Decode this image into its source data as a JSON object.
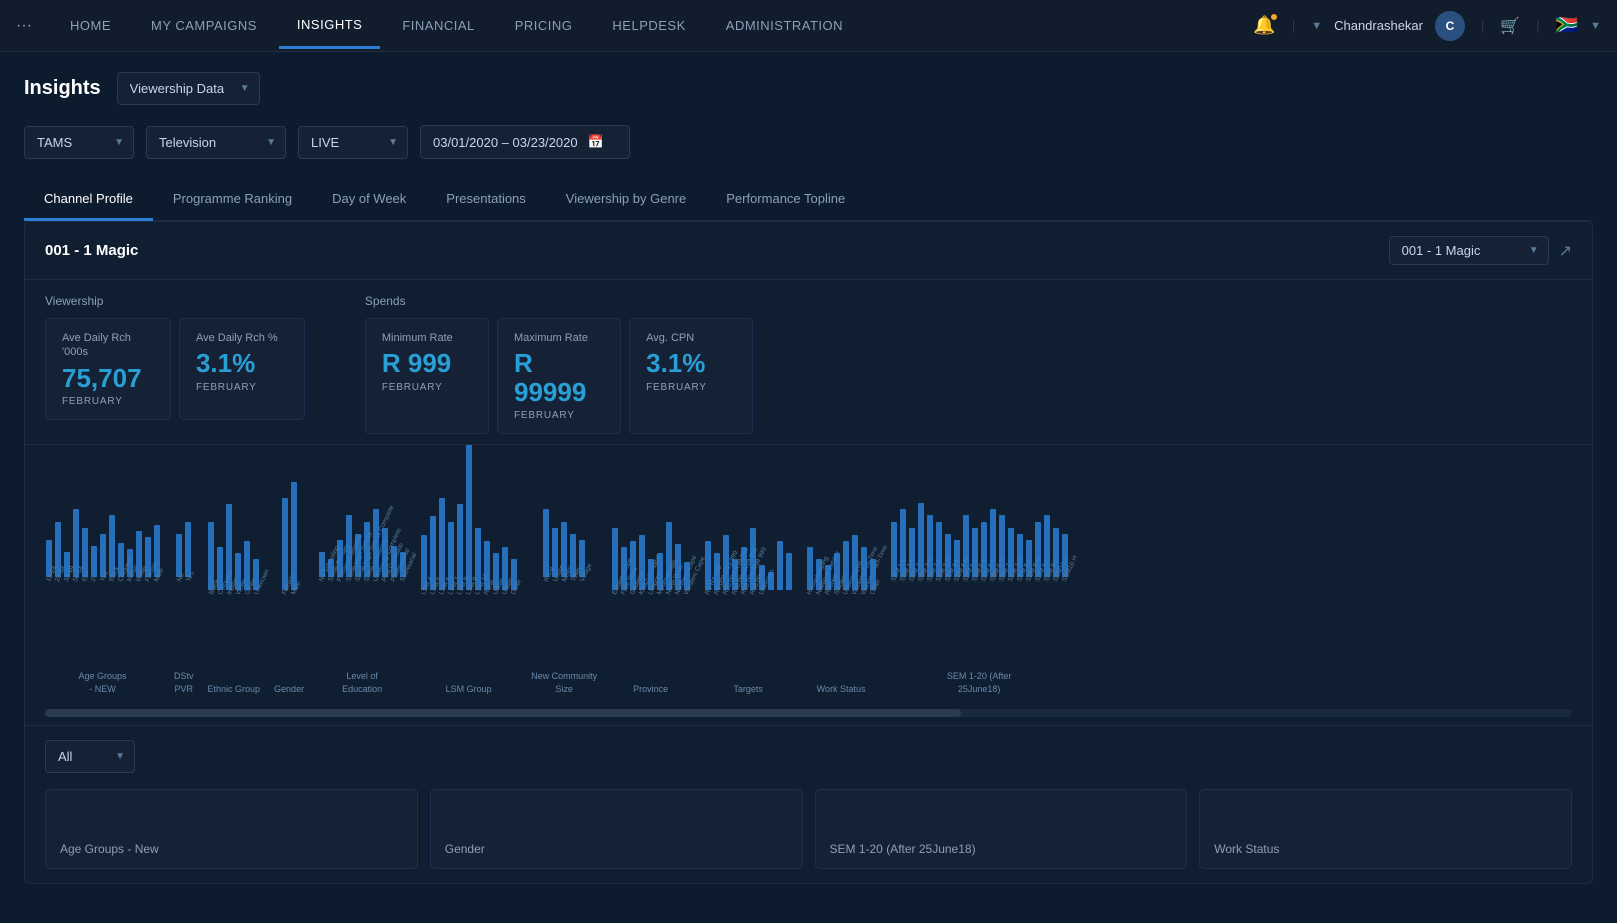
{
  "nav": {
    "dots_label": "···",
    "links": [
      {
        "label": "HOME",
        "active": false
      },
      {
        "label": "MY CAMPAIGNS",
        "active": false
      },
      {
        "label": "INSIGHTS",
        "active": true
      },
      {
        "label": "FINANCIAL",
        "active": false
      },
      {
        "label": "PRICING",
        "active": false
      },
      {
        "label": "HELPDESK",
        "active": false
      },
      {
        "label": "ADMINISTRATION",
        "active": false
      }
    ],
    "user_name": "Chandrashekar",
    "avatar_initials": "C"
  },
  "page": {
    "title": "Insights",
    "dropdown_label": "Viewership Data"
  },
  "filters": {
    "tams": "TAMS",
    "television": "Television",
    "live": "LIVE",
    "date_range": "03/01/2020 – 03/23/2020"
  },
  "tabs": [
    {
      "label": "Channel Profile",
      "active": true
    },
    {
      "label": "Programme Ranking",
      "active": false
    },
    {
      "label": "Day of Week",
      "active": false
    },
    {
      "label": "Presentations",
      "active": false
    },
    {
      "label": "Viewership by Genre",
      "active": false
    },
    {
      "label": "Performance Topline",
      "active": false
    }
  ],
  "channel_card": {
    "title": "001 - 1 Magic",
    "channel_select": "001 - 1 Magic"
  },
  "viewership_label": "Viewership",
  "spends_label": "Spends",
  "metrics": [
    {
      "label": "Ave Daily Rch '000s",
      "value": "75,707",
      "period": "FEBRUARY"
    },
    {
      "label": "Ave Daily Rch %",
      "value": "3.1%",
      "period": "FEBRUARY"
    },
    {
      "label": "Minimum Rate",
      "value": "R 999",
      "period": "FEBRUARY"
    },
    {
      "label": "Maximum Rate",
      "value": "R 99999",
      "period": "FEBRUARY"
    },
    {
      "label": "Avg. CPN",
      "value": "3.1%",
      "period": "FEBRUARY"
    }
  ],
  "chart": {
    "groups": [
      {
        "name": "Age Groups\n- NEW",
        "bars": [
          12,
          18,
          8,
          22,
          16,
          10,
          14,
          20,
          11,
          9,
          15,
          13,
          17
        ]
      },
      {
        "name": "DStv\nPVR",
        "bars": [
          14,
          18
        ]
      },
      {
        "name": "Ethnic Group",
        "bars": [
          22,
          14,
          28,
          12,
          16,
          10
        ]
      },
      {
        "name": "Gender",
        "bars": [
          30,
          35
        ]
      },
      {
        "name": "Level of Education",
        "bars": [
          8,
          6,
          12,
          20,
          14,
          18,
          22,
          16,
          10,
          8
        ]
      },
      {
        "name": "LSM Group",
        "bars": [
          18,
          24,
          30,
          22,
          28,
          65,
          20,
          16,
          12,
          14,
          10
        ]
      },
      {
        "name": "New Community\nSize",
        "bars": [
          22,
          16,
          18,
          14,
          12
        ]
      },
      {
        "name": "Province",
        "bars": [
          20,
          14,
          16,
          18,
          10,
          12,
          22,
          15,
          9
        ]
      },
      {
        "name": "Targets",
        "bars": [
          16,
          12,
          18,
          10,
          14,
          20,
          8,
          6,
          16,
          12
        ]
      },
      {
        "name": "Work Status",
        "bars": [
          14,
          10,
          8,
          12,
          16,
          18,
          14,
          10
        ]
      },
      {
        "name": "SEM 1-20 (After 25June18)",
        "bars": [
          18,
          22,
          16,
          24,
          20,
          18,
          14,
          12,
          20,
          16,
          18,
          22,
          20,
          16,
          14,
          12,
          18,
          20,
          16,
          14
        ]
      }
    ]
  },
  "filter_all": "All",
  "bottom_cards": [
    {
      "label": "Age Groups - New"
    },
    {
      "label": "Gender"
    },
    {
      "label": "SEM 1-20 (After 25June18)"
    },
    {
      "label": "Work Status"
    }
  ]
}
